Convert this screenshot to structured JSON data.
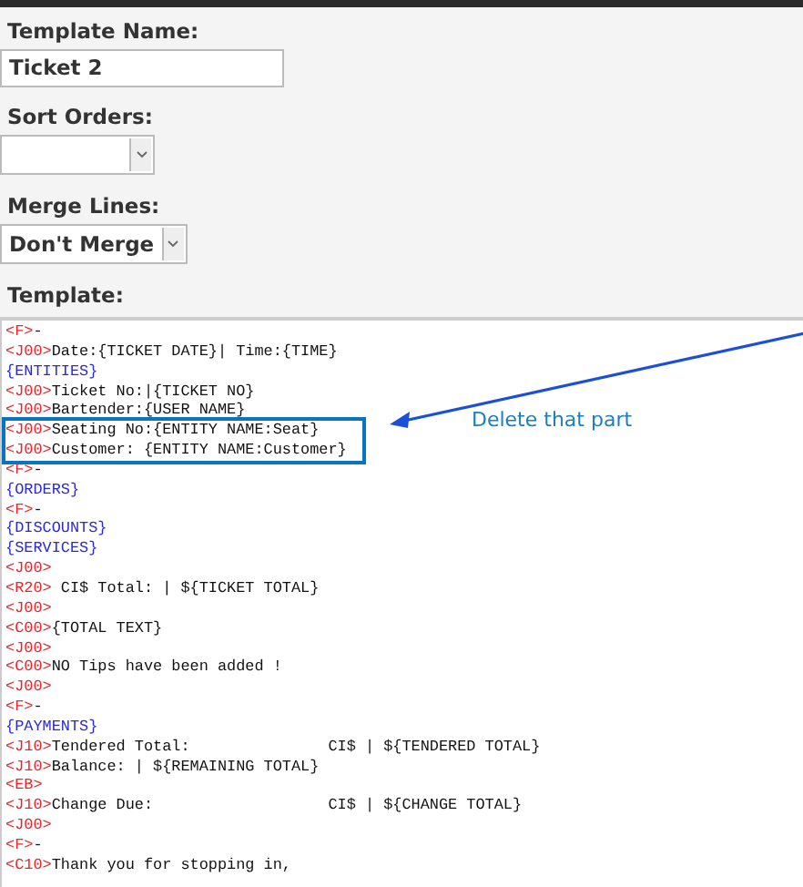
{
  "fields": [
    {
      "label": "Template Name:",
      "kind": "text",
      "value": "Ticket 2"
    },
    {
      "label": "Sort Orders:",
      "kind": "select"
    },
    {
      "label": "Merge Lines:",
      "kind": "select",
      "value": "Don't Merge"
    }
  ],
  "template": {
    "label": "Template:",
    "lines": [
      {
        "kind": "tagged",
        "tag": "<F>",
        "text": "-",
        "highlighted": false
      },
      {
        "kind": "tagged",
        "tag": "<J00>",
        "text": "Date:{TICKET DATE}| Time:{TIME}",
        "highlighted": false
      },
      {
        "kind": "section",
        "text": "{ENTITIES}",
        "highlighted": false
      },
      {
        "kind": "tagged",
        "tag": "<J00>",
        "text": "Ticket No:|{TICKET NO}",
        "highlighted": false
      },
      {
        "kind": "tagged",
        "tag": "<J00>",
        "text": "Bartender:{USER NAME}",
        "highlighted": false
      },
      {
        "kind": "tagged",
        "tag": "<J00>",
        "text": "Seating No:{ENTITY NAME:Seat}",
        "highlighted": true
      },
      {
        "kind": "tagged",
        "tag": "<J00>",
        "text": "Customer: {ENTITY NAME:Customer}",
        "highlighted": true
      },
      {
        "kind": "tagged",
        "tag": "<F>",
        "text": "-",
        "highlighted": false
      },
      {
        "kind": "section",
        "text": "{ORDERS}",
        "highlighted": false
      },
      {
        "kind": "tagged",
        "tag": "<F>",
        "text": "-",
        "highlighted": false
      },
      {
        "kind": "section",
        "text": "{DISCOUNTS}",
        "highlighted": false
      },
      {
        "kind": "section",
        "text": "{SERVICES}",
        "highlighted": false
      },
      {
        "kind": "tagged",
        "tag": "<J00>",
        "highlighted": false
      },
      {
        "kind": "tagged",
        "tag": "<R20>",
        "text": " CI$ Total: | ${TICKET TOTAL}",
        "highlighted": false
      },
      {
        "kind": "tagged",
        "tag": "<J00>",
        "highlighted": false
      },
      {
        "kind": "tagged",
        "tag": "<C00>",
        "text": "{TOTAL TEXT}",
        "highlighted": false
      },
      {
        "kind": "tagged",
        "tag": "<J00>",
        "highlighted": false
      },
      {
        "kind": "tagged",
        "tag": "<C00>",
        "text": "NO Tips have been added !",
        "highlighted": false
      },
      {
        "kind": "tagged",
        "tag": "<J00>",
        "highlighted": false
      },
      {
        "kind": "tagged",
        "tag": "<F>",
        "text": "-",
        "highlighted": false
      },
      {
        "kind": "section",
        "text": "{PAYMENTS}",
        "highlighted": false
      },
      {
        "kind": "tagged",
        "tag": "<J10>",
        "text": "Tendered Total:               CI$ | ${TENDERED TOTAL}",
        "highlighted": false
      },
      {
        "kind": "tagged",
        "tag": "<J10>",
        "text": "Balance: | ${REMAINING TOTAL}",
        "highlighted": false
      },
      {
        "kind": "tagged",
        "tag": "<EB>",
        "highlighted": false
      },
      {
        "kind": "tagged",
        "tag": "<J10>",
        "text": "Change Due:                   CI$ | ${CHANGE TOTAL}",
        "highlighted": false
      },
      {
        "kind": "tagged",
        "tag": "<J00>",
        "highlighted": false
      },
      {
        "kind": "tagged",
        "tag": "<F>",
        "text": "-",
        "highlighted": false
      },
      {
        "kind": "tagged",
        "tag": "<C10>",
        "text": "Thank you for stopping in,",
        "highlighted": false
      }
    ]
  },
  "annotation": {
    "text": "Delete that part"
  }
}
